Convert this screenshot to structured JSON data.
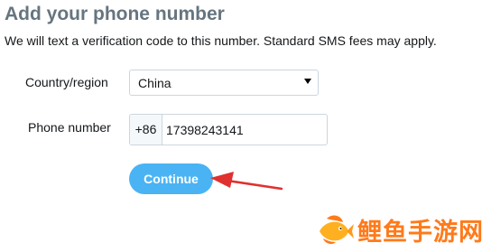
{
  "page": {
    "title": "Add your phone number",
    "subtitle": "We will text a verification code to this number. Standard SMS fees may apply."
  },
  "form": {
    "country_label": "Country/region",
    "country_value": "China",
    "phone_label": "Phone number",
    "phone_prefix": "+86",
    "phone_value": "17398243141",
    "continue_label": "Continue"
  },
  "watermark": {
    "text": "鲤鱼手游网"
  },
  "colors": {
    "title": "#66757f",
    "accent": "#4ab3f4",
    "annotation_arrow": "#e0302f",
    "watermark": "#ff7a1a"
  },
  "icons": {
    "select_caret": "caret-down-icon",
    "annotation": "red-arrow-icon",
    "watermark_logo": "fish-logo-icon"
  }
}
